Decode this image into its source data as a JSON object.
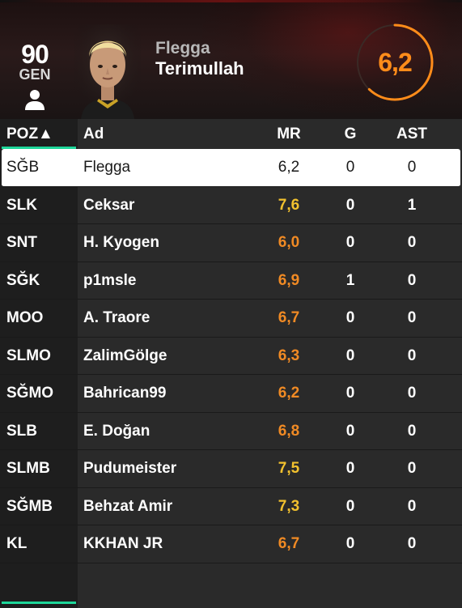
{
  "player": {
    "overall": "90",
    "overall_label": "GEN",
    "first_name": "Flegga",
    "last_name": "Terimullah",
    "match_rating": "6,2"
  },
  "table": {
    "headers": {
      "pos": "POZ▲",
      "name": "Ad",
      "mr": "MR",
      "g": "G",
      "ast": "AST"
    },
    "rows": [
      {
        "pos": "SĞB",
        "name": "Flegga",
        "mr": "6,2",
        "g": "0",
        "ast": "0",
        "selected": true
      },
      {
        "pos": "SLK",
        "name": "Ceksar",
        "mr": "7,6",
        "g": "0",
        "ast": "1"
      },
      {
        "pos": "SNT",
        "name": "H. Kyogen",
        "mr": "6,0",
        "g": "0",
        "ast": "0"
      },
      {
        "pos": "SĞK",
        "name": "p1msle",
        "mr": "6,9",
        "g": "1",
        "ast": "0"
      },
      {
        "pos": "MOO",
        "name": "A. Traore",
        "mr": "6,7",
        "g": "0",
        "ast": "0"
      },
      {
        "pos": "SLMO",
        "name": "ZalimGölge",
        "mr": "6,3",
        "g": "0",
        "ast": "0"
      },
      {
        "pos": "SĞMO",
        "name": "Bahrican99",
        "mr": "6,2",
        "g": "0",
        "ast": "0"
      },
      {
        "pos": "SLB",
        "name": "E. Doğan",
        "mr": "6,8",
        "g": "0",
        "ast": "0"
      },
      {
        "pos": "SLMB",
        "name": "Pudumeister",
        "mr": "7,5",
        "g": "0",
        "ast": "0"
      },
      {
        "pos": "SĞMB",
        "name": "Behzat Amir",
        "mr": "7,3",
        "g": "0",
        "ast": "0"
      },
      {
        "pos": "KL",
        "name": "KKHAN JR",
        "mr": "6,7",
        "g": "0",
        "ast": "0"
      }
    ]
  },
  "colors": {
    "rating_high": "#f2c12e",
    "rating_low": "#f08a24",
    "accent": "#1ed79a",
    "ring": "#ff8c1a"
  },
  "icons": {
    "profile": "person-icon",
    "rating_ring": "rating-ring-icon",
    "portrait": "player-portrait"
  }
}
